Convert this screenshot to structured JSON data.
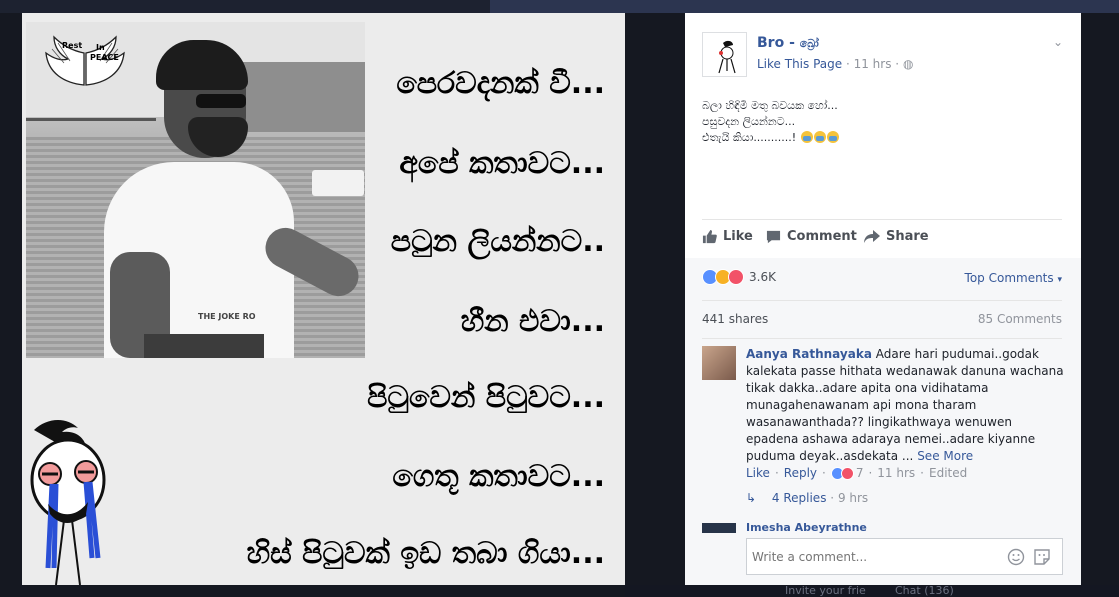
{
  "photo": {
    "badge_text_1": "Rest",
    "badge_text_2": "In",
    "badge_text_3": "PEACE",
    "shirt_text": "THE JOKE RO",
    "verses": [
      "පෙරවදනක් වී...",
      "අපේ කතාවට...",
      "පටුන ලියන්නට..",
      "හීන එවා...",
      "පිටුවෙන් පිටුවට...",
      "ගෙතූ කතාවට...",
      "හිස් පිටුවක් ඉඩ තබා ගියා..."
    ]
  },
  "post": {
    "page_name": "Bro - ",
    "page_name_si": "බ්‍රෝ",
    "like_page": "Like This Page",
    "time": "11 hrs",
    "body_lines": [
      "බලා හිඳිමි මතු බවයක හෝ...",
      "පසුවදන ලියන්නට...",
      "එතැයි කියා...........!"
    ],
    "like_label": "Like",
    "comment_label": "Comment",
    "share_label": "Share",
    "reactions_count": "3.6K",
    "top_comments": "Top Comments",
    "shares": "441 shares",
    "comments_count": "85 Comments",
    "comment": {
      "author": "Aanya Rathnayaka",
      "text": "Adare hari pudumai..godak kalekata passe hithata wedanawak danuna wachana tikak dakka..adare apita ona vidihatama munagahenawanam api mona tharam wasanawanthada?? lingikathwaya wenuwen epadena ashawa adaraya nemei..adare kiyanne puduma deyak..asdekata ...",
      "see_more": "See More",
      "like": "Like",
      "reply": "Reply",
      "reaction_count": "7",
      "time": "11 hrs",
      "edited": "Edited",
      "replies": "4 Replies",
      "replies_time": "9 hrs"
    },
    "next_comment_author": "Imesha Abeyrathne",
    "write_placeholder": "Write a comment..."
  },
  "background": {
    "invite": "Invite your frie",
    "chat": "Chat (136)"
  },
  "colors": {
    "fb_blue": "#365899",
    "meta_grey": "#90949c"
  }
}
